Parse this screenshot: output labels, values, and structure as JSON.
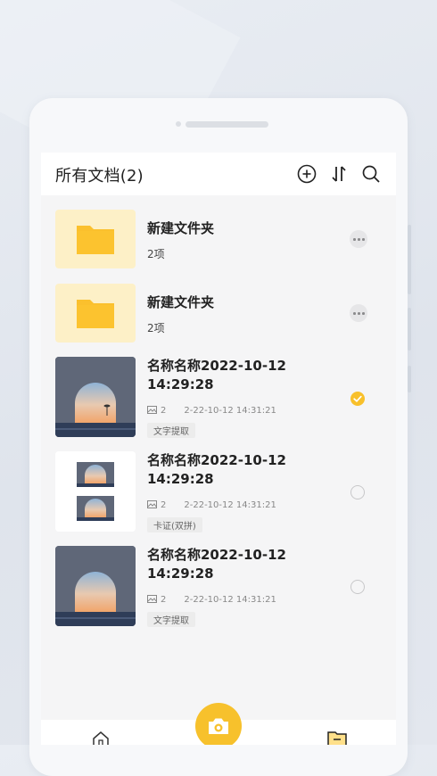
{
  "header": {
    "title": "所有文档(2)"
  },
  "items": [
    {
      "type": "folder",
      "name": "新建文件夹",
      "sub": "2项"
    },
    {
      "type": "folder",
      "name": "新建文件夹",
      "sub": "2项"
    },
    {
      "type": "photo",
      "name": "名称名称2022-10-12 14:29:28",
      "count": "2",
      "date": "2-22-10-12  14:31:21",
      "tag": "文字提取",
      "state": "checked"
    },
    {
      "type": "doc",
      "name": "名称名称2022-10-12 14:29:28",
      "count": "2",
      "date": "2-22-10-12  14:31:21",
      "tag": "卡证(双拼)",
      "state": "unchecked"
    },
    {
      "type": "photo",
      "name": "名称名称2022-10-12 14:29:28",
      "count": "2",
      "date": "2-22-10-12  14:31:21",
      "tag": "文字提取",
      "state": "unchecked"
    }
  ],
  "icons": {
    "header": [
      "add-icon",
      "sort-icon",
      "search-icon"
    ],
    "item": [
      "folder-icon",
      "more-icon",
      "image-count-icon",
      "checkbox-icon"
    ],
    "nav": [
      "home-icon",
      "camera-icon",
      "documents-icon"
    ]
  },
  "colors": {
    "accent": "#f7c12c",
    "folder_bg": "#fdf0c7",
    "folder": "#fbc02d"
  }
}
